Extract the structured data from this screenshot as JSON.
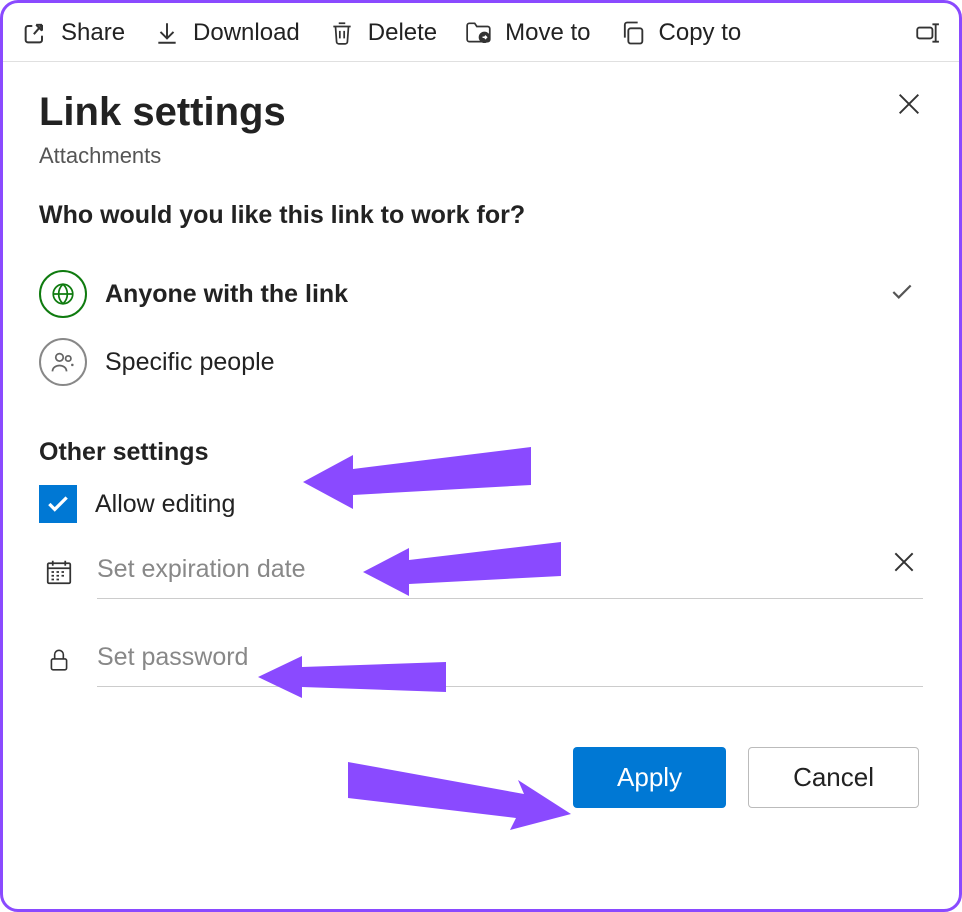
{
  "toolbar": {
    "share": "Share",
    "download": "Download",
    "delete": "Delete",
    "moveto": "Move to",
    "copyto": "Copy to"
  },
  "panel": {
    "title": "Link settings",
    "subtitle": "Attachments",
    "question": "Who would you like this link to work for?"
  },
  "options": {
    "anyone": "Anyone with the link",
    "specific": "Specific people"
  },
  "other": {
    "heading": "Other settings",
    "allow_editing": "Allow editing",
    "expiration_placeholder": "Set expiration date",
    "password_placeholder": "Set password"
  },
  "footer": {
    "apply": "Apply",
    "cancel": "Cancel"
  }
}
